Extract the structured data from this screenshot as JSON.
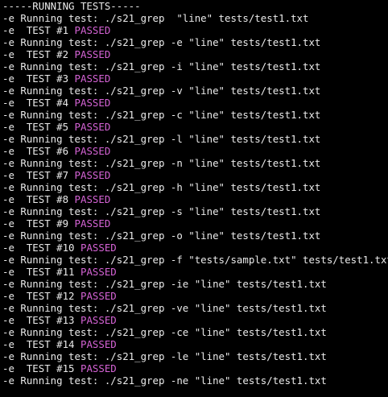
{
  "terminal": {
    "colors": {
      "background": "#000000",
      "text": "#eaeaea",
      "passed": "#d563d5"
    },
    "lines": [
      {
        "text": "-----RUNNING TESTS-----",
        "status": ""
      },
      {
        "text": "-e Running test: ./s21_grep  \"line\" tests/test1.txt",
        "status": ""
      },
      {
        "text": "-e  TEST #1 ",
        "status": "PASSED"
      },
      {
        "text": "-e Running test: ./s21_grep -e \"line\" tests/test1.txt",
        "status": ""
      },
      {
        "text": "-e  TEST #2 ",
        "status": "PASSED"
      },
      {
        "text": "-e Running test: ./s21_grep -i \"line\" tests/test1.txt",
        "status": ""
      },
      {
        "text": "-e  TEST #3 ",
        "status": "PASSED"
      },
      {
        "text": "-e Running test: ./s21_grep -v \"line\" tests/test1.txt",
        "status": ""
      },
      {
        "text": "-e  TEST #4 ",
        "status": "PASSED"
      },
      {
        "text": "-e Running test: ./s21_grep -c \"line\" tests/test1.txt",
        "status": ""
      },
      {
        "text": "-e  TEST #5 ",
        "status": "PASSED"
      },
      {
        "text": "-e Running test: ./s21_grep -l \"line\" tests/test1.txt",
        "status": ""
      },
      {
        "text": "-e  TEST #6 ",
        "status": "PASSED"
      },
      {
        "text": "-e Running test: ./s21_grep -n \"line\" tests/test1.txt",
        "status": ""
      },
      {
        "text": "-e  TEST #7 ",
        "status": "PASSED"
      },
      {
        "text": "-e Running test: ./s21_grep -h \"line\" tests/test1.txt",
        "status": ""
      },
      {
        "text": "-e  TEST #8 ",
        "status": "PASSED"
      },
      {
        "text": "-e Running test: ./s21_grep -s \"line\" tests/test1.txt",
        "status": ""
      },
      {
        "text": "-e  TEST #9 ",
        "status": "PASSED"
      },
      {
        "text": "-e Running test: ./s21_grep -o \"line\" tests/test1.txt",
        "status": ""
      },
      {
        "text": "-e  TEST #10 ",
        "status": "PASSED"
      },
      {
        "text": "-e Running test: ./s21_grep -f \"tests/sample.txt\" tests/test1.txt",
        "status": ""
      },
      {
        "text": "-e  TEST #11 ",
        "status": "PASSED"
      },
      {
        "text": "-e Running test: ./s21_grep -ie \"line\" tests/test1.txt",
        "status": ""
      },
      {
        "text": "-e  TEST #12 ",
        "status": "PASSED"
      },
      {
        "text": "-e Running test: ./s21_grep -ve \"line\" tests/test1.txt",
        "status": ""
      },
      {
        "text": "-e  TEST #13 ",
        "status": "PASSED"
      },
      {
        "text": "-e Running test: ./s21_grep -ce \"line\" tests/test1.txt",
        "status": ""
      },
      {
        "text": "-e  TEST #14 ",
        "status": "PASSED"
      },
      {
        "text": "-e Running test: ./s21_grep -le \"line\" tests/test1.txt",
        "status": ""
      },
      {
        "text": "-e  TEST #15 ",
        "status": "PASSED"
      },
      {
        "text": "-e Running test: ./s21_grep -ne \"line\" tests/test1.txt",
        "status": ""
      }
    ]
  }
}
